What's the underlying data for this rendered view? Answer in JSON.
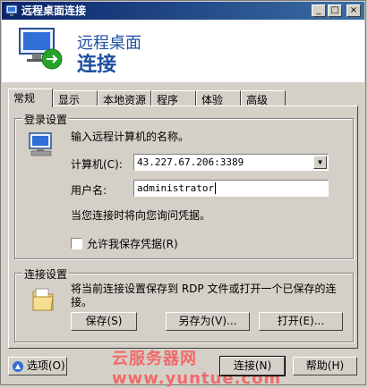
{
  "window": {
    "title": "远程桌面连接"
  },
  "banner": {
    "line1": "远程桌面",
    "line2": "连接"
  },
  "tabs": [
    {
      "label": "常规"
    },
    {
      "label": "显示"
    },
    {
      "label": "本地资源"
    },
    {
      "label": "程序"
    },
    {
      "label": "体验"
    },
    {
      "label": "高级"
    }
  ],
  "login": {
    "group_label": "登录设置",
    "prompt": "输入远程计算机的名称。",
    "computer_label": "计算机(C):",
    "computer_value": "43.227.67.206:3389",
    "username_label": "用户名:",
    "username_value": "administrator",
    "hint": "当您连接时将向您询问凭据。",
    "save_creds_label": "允许我保存凭据(R)"
  },
  "connection": {
    "group_label": "连接设置",
    "desc": "将当前连接设置保存到 RDP 文件或打开一个已保存的连接。",
    "save_btn": "保存(S)",
    "save_as_btn": "另存为(V)...",
    "open_btn": "打开(E)..."
  },
  "footer": {
    "options_btn": "选项(O)",
    "connect_btn": "连接(N)",
    "help_btn": "帮助(H)"
  },
  "watermark": "云服务器网 www.yuntue.com"
}
